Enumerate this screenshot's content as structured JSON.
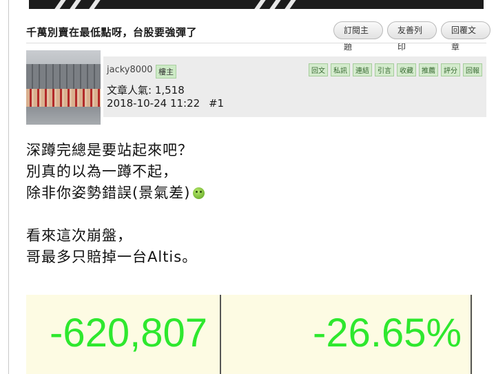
{
  "post": {
    "title": "千萬別賣在最低點呀，台股要強彈了",
    "buttons": [
      "訂閱主題",
      "友善列印",
      "回覆文章"
    ]
  },
  "author": {
    "username": "jacky8000",
    "badge": "樓主",
    "popularity": "文章人氣: 1,518",
    "datetime": "2018-10-24 11:22",
    "floor": "#1",
    "actions": [
      "回文",
      "私訊",
      "連結",
      "引言",
      "收藏",
      "推薦",
      "評分",
      "回報"
    ]
  },
  "body": {
    "lines": [
      "深蹲完總是要站起來吧？",
      "別真的以為一蹲不起，",
      "除非你姿勢錯誤(景氣差)",
      "看來這次崩盤，",
      "哥最多只賠掉一台Altis。"
    ],
    "emoji_icon": "green-grinning-face-icon"
  },
  "summary": {
    "loss_amount": "-620,807",
    "loss_percent": "-26.65%",
    "text_color": "#2ee82e",
    "background": "#fdfbe3"
  }
}
